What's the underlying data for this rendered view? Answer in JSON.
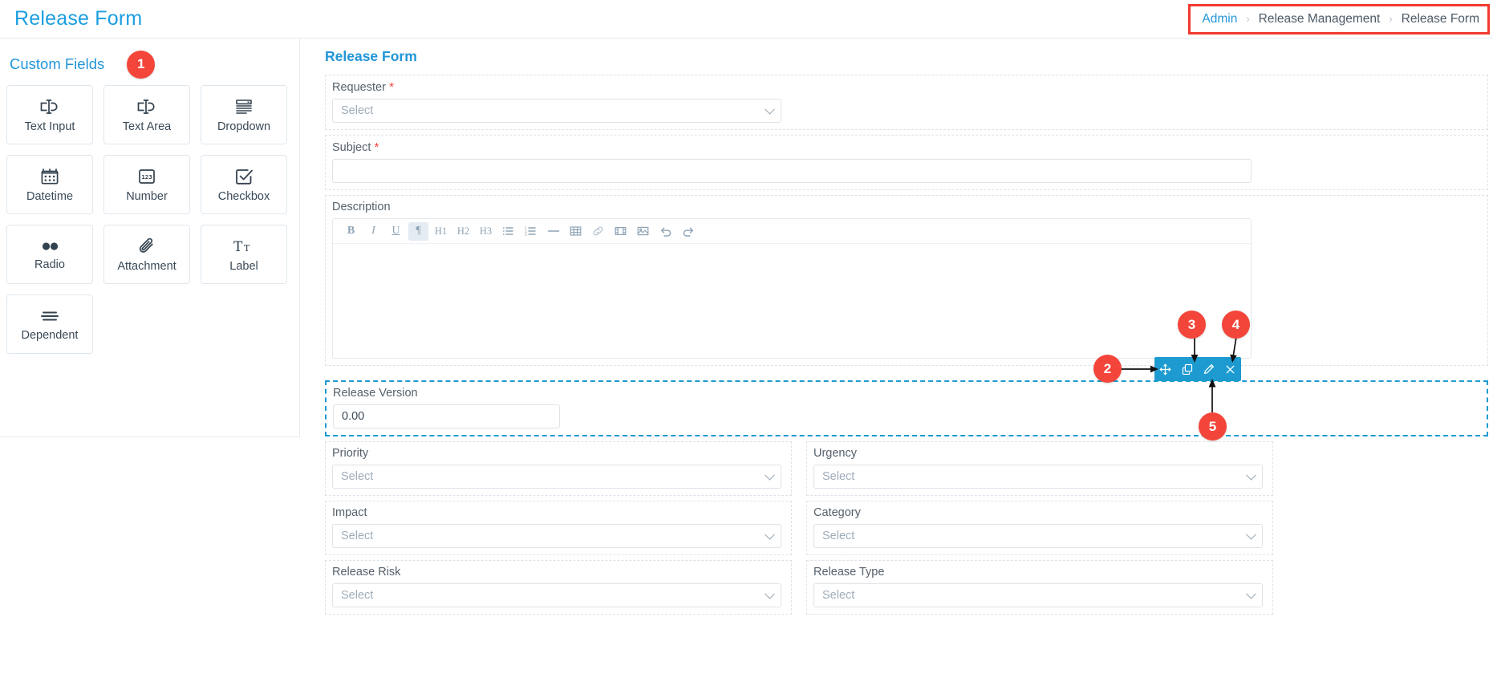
{
  "header": {
    "title": "Release Form",
    "breadcrumb": [
      {
        "label": "Admin",
        "type": "link"
      },
      {
        "label": "Release Management",
        "type": "text"
      },
      {
        "label": "Release Form",
        "type": "text"
      }
    ],
    "separator": "›"
  },
  "palette": {
    "title": "Custom Fields",
    "badge": "1",
    "tiles": [
      {
        "label": "Text Input",
        "icon": "text-input-icon"
      },
      {
        "label": "Text Area",
        "icon": "text-area-icon"
      },
      {
        "label": "Dropdown",
        "icon": "dropdown-icon"
      },
      {
        "label": "Datetime",
        "icon": "calendar-icon"
      },
      {
        "label": "Number",
        "icon": "number-123-icon"
      },
      {
        "label": "Checkbox",
        "icon": "checkbox-icon"
      },
      {
        "label": "Radio",
        "icon": "radio-icon"
      },
      {
        "label": "Attachment",
        "icon": "paperclip-icon"
      },
      {
        "label": "Label",
        "icon": "text-format-icon"
      },
      {
        "label": "Dependent",
        "icon": "hamburger-lines-icon"
      }
    ]
  },
  "form": {
    "title": "Release Form",
    "fields": {
      "requester": {
        "label": "Requester",
        "required": true,
        "placeholder": "Select"
      },
      "subject": {
        "label": "Subject",
        "required": true,
        "value": ""
      },
      "description": {
        "label": "Description",
        "required": false,
        "value": ""
      },
      "release_version": {
        "label": "Release Version",
        "required": false,
        "value": "0.00"
      },
      "priority": {
        "label": "Priority",
        "required": false,
        "placeholder": "Select"
      },
      "urgency": {
        "label": "Urgency",
        "required": false,
        "placeholder": "Select"
      },
      "impact": {
        "label": "Impact",
        "required": false,
        "placeholder": "Select"
      },
      "category": {
        "label": "Category",
        "required": false,
        "placeholder": "Select"
      },
      "release_risk": {
        "label": "Release Risk",
        "required": false,
        "placeholder": "Select"
      },
      "release_type": {
        "label": "Release Type",
        "required": false,
        "placeholder": "Select"
      }
    },
    "editor_toolbar": [
      {
        "name": "bold-icon",
        "label": "B",
        "active": false
      },
      {
        "name": "italic-icon",
        "label": "I",
        "active": false
      },
      {
        "name": "underline-icon",
        "label": "U",
        "active": false
      },
      {
        "name": "paragraph-icon",
        "label": "¶",
        "active": true
      },
      {
        "name": "heading-1-icon",
        "label": "H1",
        "active": false
      },
      {
        "name": "heading-2-icon",
        "label": "H2",
        "active": false
      },
      {
        "name": "heading-3-icon",
        "label": "H3",
        "active": false
      },
      {
        "name": "bullet-list-icon",
        "label": "",
        "active": false
      },
      {
        "name": "numbered-list-icon",
        "label": "",
        "active": false
      },
      {
        "name": "horizontal-rule-icon",
        "label": "",
        "active": false
      },
      {
        "name": "table-icon",
        "label": "",
        "active": false
      },
      {
        "name": "link-icon",
        "label": "",
        "active": false
      },
      {
        "name": "video-icon",
        "label": "",
        "active": false
      },
      {
        "name": "image-icon",
        "label": "",
        "active": false
      },
      {
        "name": "undo-icon",
        "label": "",
        "active": false
      },
      {
        "name": "redo-icon",
        "label": "",
        "active": false
      }
    ]
  },
  "action_toolbar": {
    "badge_toolbar": "2",
    "badge_copy": "3",
    "badge_close": "4",
    "badge_edit": "5",
    "buttons": [
      {
        "name": "move-handle-icon",
        "title": "Move"
      },
      {
        "name": "copy-icon",
        "title": "Copy"
      },
      {
        "name": "edit-pencil-icon",
        "title": "Edit"
      },
      {
        "name": "close-x-icon",
        "title": "Remove"
      }
    ],
    "background": "#1d9bd1"
  },
  "colors": {
    "accent": "#2196d8",
    "badge": "#f4453a",
    "highlight_border": "#f33a2e",
    "toolbar_blue": "#1d9bd1",
    "required": "#f4453a"
  }
}
